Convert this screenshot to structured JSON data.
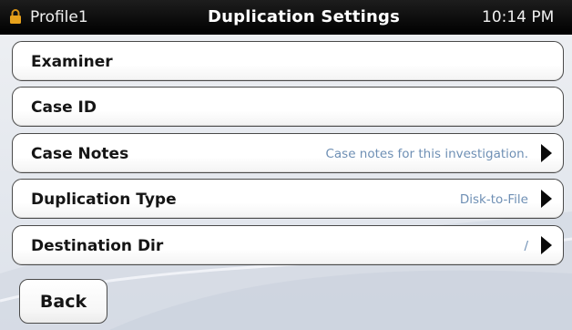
{
  "status_bar": {
    "profile": "Profile1",
    "title": "Duplication Settings",
    "time": "10:14 PM",
    "lock_icon": "lock-icon"
  },
  "settings": [
    {
      "label": "Examiner",
      "value": "",
      "has_chevron": false
    },
    {
      "label": "Case ID",
      "value": "",
      "has_chevron": false
    },
    {
      "label": "Case Notes",
      "value": "Case notes for this investigation.",
      "has_chevron": true
    },
    {
      "label": "Duplication Type",
      "value": "Disk-to-File",
      "has_chevron": true
    },
    {
      "label": "Destination Dir",
      "value": "/",
      "has_chevron": true
    }
  ],
  "footer": {
    "back_label": "Back"
  },
  "colors": {
    "status_bar": "#000000",
    "value_text": "#6e8fb4",
    "lock": "#e8a21c"
  }
}
